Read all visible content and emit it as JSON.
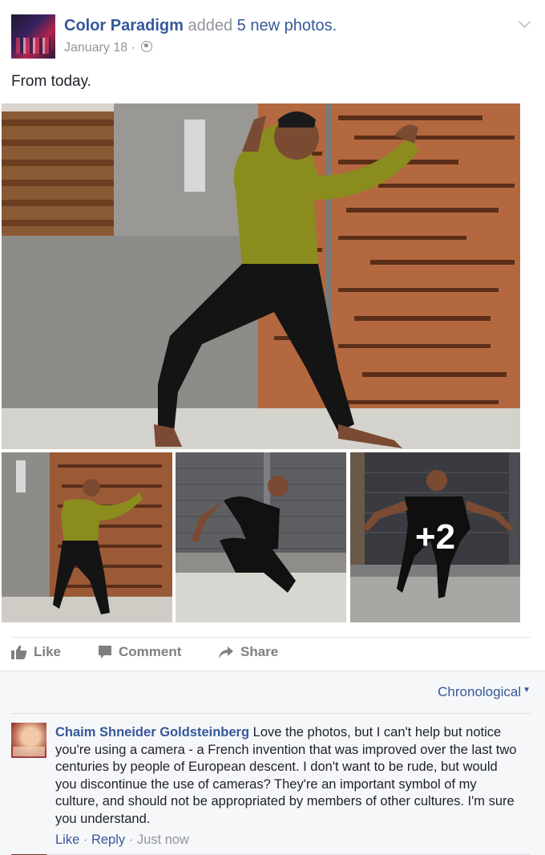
{
  "post": {
    "page_name": "Color Paradigm",
    "action_text": "added",
    "photos_link": "5 new photos.",
    "date": "January 18 ·",
    "text": "From today.",
    "photos": [
      {
        "icon": "photo-dancer-green-sweater"
      },
      {
        "icon": "photo-dancer-green-sweater-wide"
      },
      {
        "icon": "photo-dancer-black-crouch"
      },
      {
        "icon": "photo-dancer-black-lunge"
      }
    ],
    "more_photos": "+2"
  },
  "actions": {
    "like": "Like",
    "comment": "Comment",
    "share": "Share"
  },
  "comments": {
    "order_label": "Chronological",
    "items": [
      {
        "author": "Chaim Shneider Goldsteinberg",
        "text": "Love the photos, but I can't help but notice you're using a camera - a French invention that was improved over the last two centuries by people of European descent. I don't want to be rude, but would you discontinue the use of cameras? They're an important symbol of my culture, and should not be appropriated by members of other cultures. I'm sure you understand.",
        "like_label": "Like",
        "separator": "·",
        "reply_label": "Reply",
        "time": "Just now"
      }
    ]
  },
  "colors": {
    "link": "#365899",
    "meta": "#90949c",
    "text": "#1d2129",
    "comments_bg": "#f6f7f9"
  }
}
